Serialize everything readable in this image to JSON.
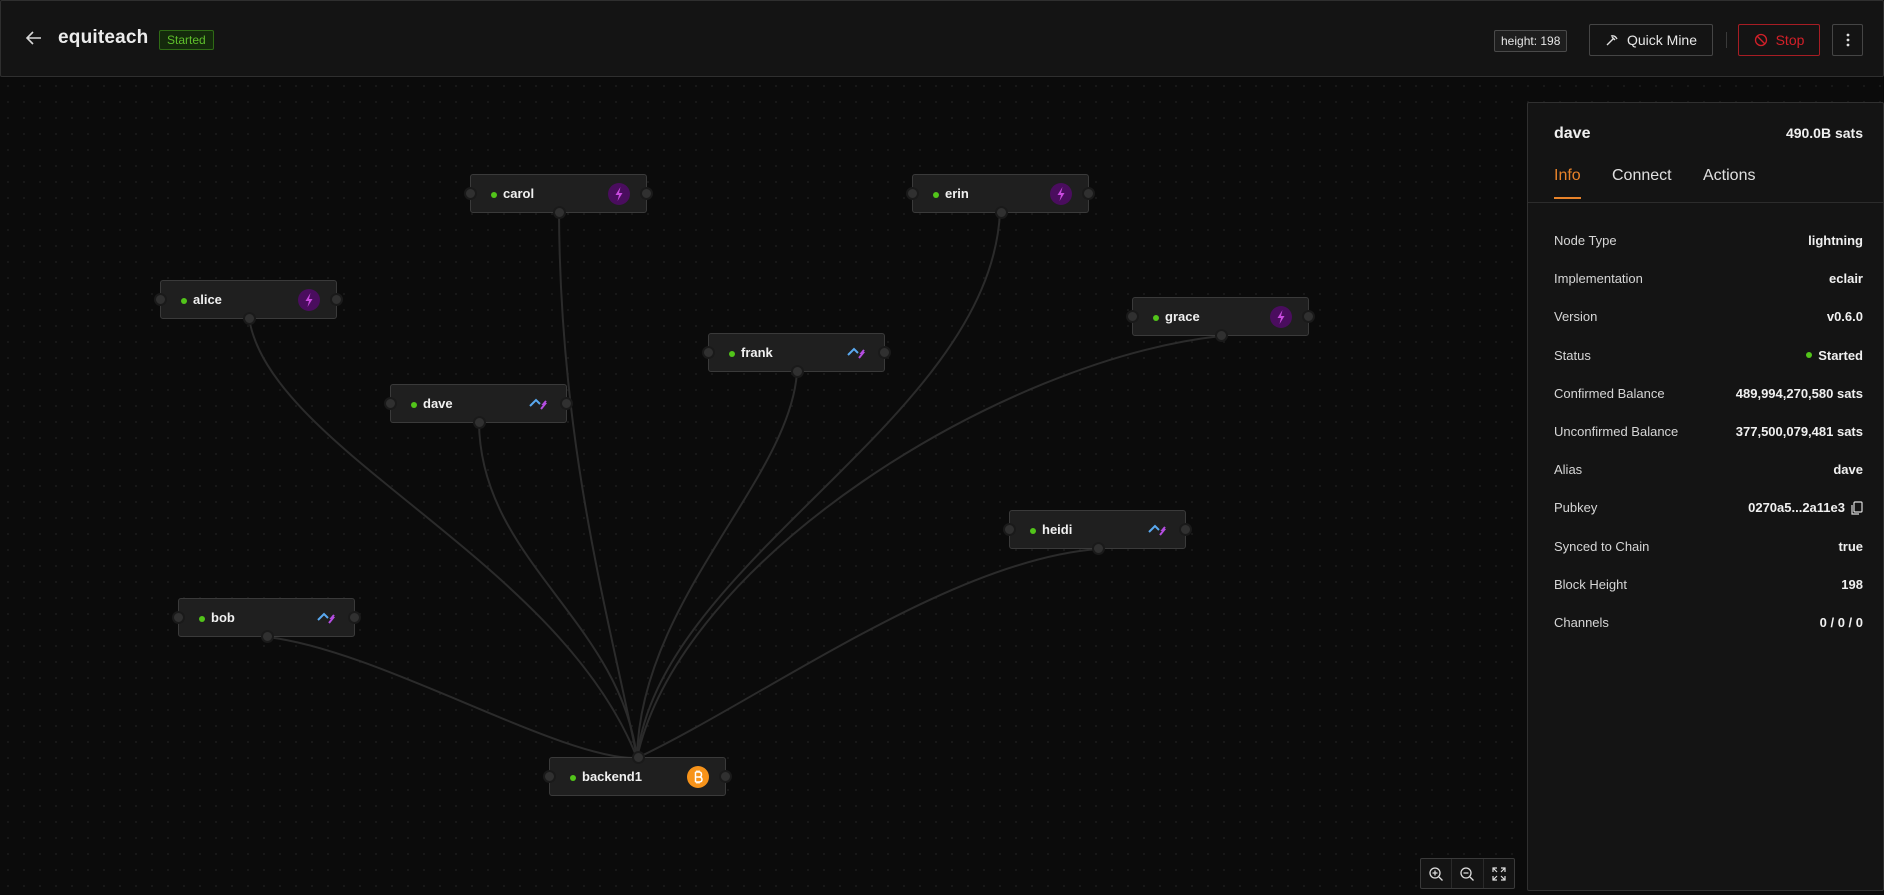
{
  "header": {
    "title": "equiteach",
    "status": "Started",
    "height_label": "height: 198",
    "quick_mine_label": "Quick Mine",
    "stop_label": "Stop"
  },
  "nodes": [
    {
      "name": "carol",
      "type": "eclair-icon"
    },
    {
      "name": "erin",
      "type": "eclair-icon"
    },
    {
      "name": "alice",
      "type": "eclair-icon"
    },
    {
      "name": "frank",
      "type": "c-lightning-icon"
    },
    {
      "name": "grace",
      "type": "eclair-icon"
    },
    {
      "name": "dave",
      "type": "c-lightning-icon"
    },
    {
      "name": "heidi",
      "type": "c-lightning-icon"
    },
    {
      "name": "bob",
      "type": "c-lightning-icon"
    },
    {
      "name": "backend1",
      "type": "bitcoin-icon"
    }
  ],
  "panel": {
    "title": "dave",
    "balance": "490.0B sats",
    "tabs": [
      "Info",
      "Connect",
      "Actions"
    ],
    "active_tab": "Info",
    "rows": [
      {
        "label": "Node Type",
        "value": "lightning"
      },
      {
        "label": "Implementation",
        "value": "eclair"
      },
      {
        "label": "Version",
        "value": "v0.6.0"
      },
      {
        "label": "Status",
        "value": "Started"
      },
      {
        "label": "Confirmed Balance",
        "value": "489,994,270,580 sats"
      },
      {
        "label": "Unconfirmed Balance",
        "value": "377,500,079,481 sats"
      },
      {
        "label": "Alias",
        "value": "dave"
      },
      {
        "label": "Pubkey",
        "value": "0270a5...2a11e3"
      },
      {
        "label": "Synced to Chain",
        "value": "true"
      },
      {
        "label": "Block Height",
        "value": "198"
      },
      {
        "label": "Channels",
        "value": "0 / 0 / 0"
      }
    ]
  },
  "colors": {
    "accent": "#e8832a",
    "started_green": "#52c41a",
    "stop_red": "#d32029",
    "eclair_purple": "#7a1fa2",
    "bitcoin_orange": "#f7931a"
  }
}
